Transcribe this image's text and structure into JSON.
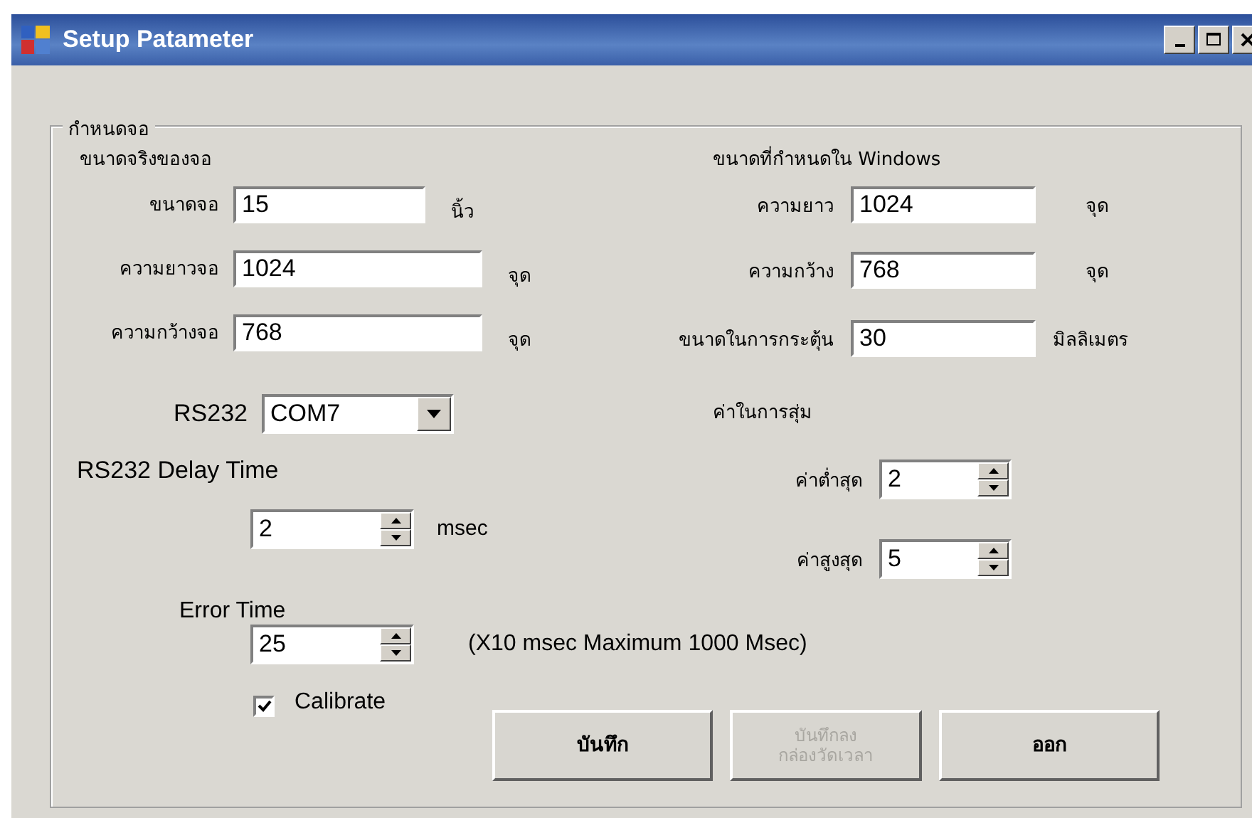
{
  "window": {
    "title": "Setup Patameter"
  },
  "group": {
    "legend": "กำหนดจอ"
  },
  "physical": {
    "heading": "ขนาดจริงของจอ",
    "fields": [
      {
        "label": "ขนาดจอ",
        "value": "15",
        "unit": "นิ้ว"
      },
      {
        "label": "ความยาวจอ",
        "value": "1024",
        "unit": "จุด"
      },
      {
        "label": "ความกว้างจอ",
        "value": "768",
        "unit": "จุด"
      }
    ]
  },
  "windows": {
    "heading": "ขนาดที่กำหนดใน Windows",
    "fields": [
      {
        "label": "ความยาว",
        "value": "1024",
        "unit": "จุด"
      },
      {
        "label": "ความกว้าง",
        "value": "768",
        "unit": "จุด"
      },
      {
        "label": "ขนาดในการกระตุ้น",
        "value": "30",
        "unit": "มิลลิเมตร"
      }
    ]
  },
  "rs232": {
    "label": "RS232",
    "value": "COM7"
  },
  "delay": {
    "label": "RS232 Delay Time",
    "value": "2",
    "unit": "msec"
  },
  "random": {
    "heading": "ค่าในการสุ่ม",
    "fields": [
      {
        "label": "ค่าต่ำสุด",
        "value": "2"
      },
      {
        "label": "ค่าสูงสุด",
        "value": "5"
      }
    ]
  },
  "error": {
    "label": "Error Time",
    "value": "25",
    "note": "(X10 msec Maximum 1000 Msec)"
  },
  "calibrate": {
    "label": "Calibrate",
    "checked": true
  },
  "buttons": [
    {
      "label": "บันทึก",
      "disabled": false
    },
    {
      "label": "บันทึกลง กล่องวัดเวลา",
      "disabled": true
    },
    {
      "label": "ออก",
      "disabled": false
    }
  ]
}
